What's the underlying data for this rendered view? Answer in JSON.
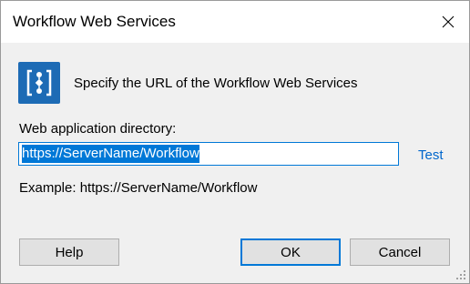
{
  "window": {
    "title": "Workflow Web Services",
    "close_icon": "close-icon"
  },
  "header": {
    "icon": "workflow-icon",
    "text": "Specify the URL of the Workflow Web Services"
  },
  "form": {
    "directory_label": "Web application directory:",
    "directory_value": "https://ServerName/Workflow",
    "test_link": "Test",
    "example_text": "Example: https://ServerName/Workflow"
  },
  "buttons": {
    "help": "Help",
    "ok": "OK",
    "cancel": "Cancel"
  },
  "colors": {
    "accent": "#0078d7",
    "icon_bg": "#1d6bb5",
    "link": "#0066cc"
  }
}
